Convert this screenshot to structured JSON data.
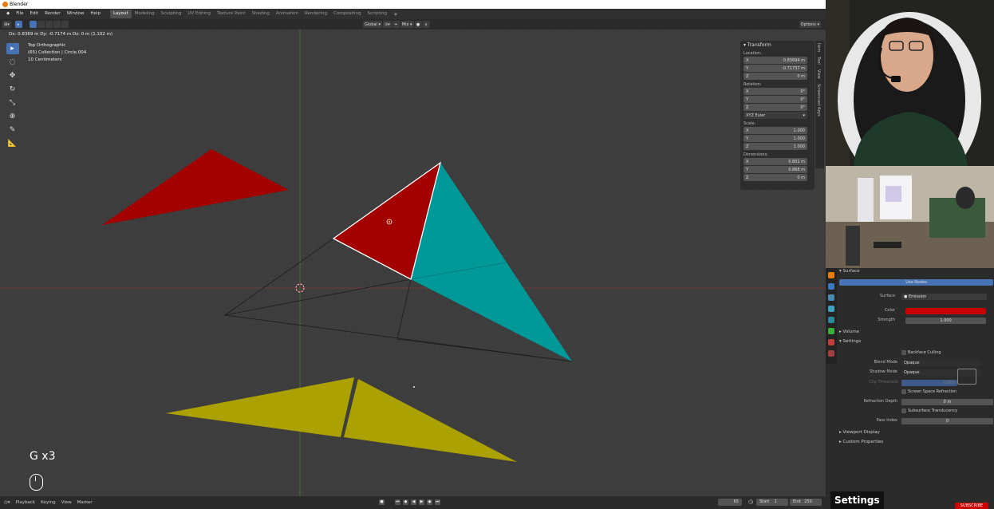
{
  "window": {
    "title": "Blender"
  },
  "menu": [
    "File",
    "Edit",
    "Render",
    "Window",
    "Help"
  ],
  "workspaces": [
    "Layout",
    "Modeling",
    "Sculpting",
    "UV Editing",
    "Texture Paint",
    "Shading",
    "Animation",
    "Rendering",
    "Compositing",
    "Scripting"
  ],
  "active_workspace": "Layout",
  "header": {
    "orientation": "Global",
    "proportional": "Mix",
    "options": "Options"
  },
  "viewport": {
    "delta": "Dx: 0.8369 m  Dy: -0.7174 m  Dz: 0 m (1.102 m)",
    "view_name": "Top Orthographic",
    "collection": "(65) Collection | Circle.004",
    "scale": "10 Centimeters",
    "keycast": "G x3"
  },
  "transform": {
    "title": "Transform",
    "location_label": "Location:",
    "location": [
      [
        "X",
        "0.83694 m"
      ],
      [
        "Y",
        "-0.71737 m"
      ],
      [
        "Z",
        "0 m"
      ]
    ],
    "rotation_label": "Rotation:",
    "rotation": [
      [
        "X",
        "0°"
      ],
      [
        "Y",
        "0°"
      ],
      [
        "Z",
        "0°"
      ]
    ],
    "rotation_mode": "XYZ Euler",
    "scale_label": "Scale:",
    "scale": [
      [
        "X",
        "1.000"
      ],
      [
        "Y",
        "1.000"
      ],
      [
        "Z",
        "1.000"
      ]
    ],
    "dimensions_label": "Dimensions:",
    "dimensions": [
      [
        "X",
        "0.802 m"
      ],
      [
        "Y",
        "0.868 m"
      ],
      [
        "Z",
        "0 m"
      ]
    ]
  },
  "npanel_tabs": [
    "Item",
    "Tool",
    "View",
    "Screencast Keys"
  ],
  "timeline": {
    "menus": [
      "Playback",
      "Keying",
      "View",
      "Marker"
    ],
    "current": "65",
    "start_label": "Start",
    "start": "1",
    "end_label": "End",
    "end": "250"
  },
  "properties": {
    "surface_header": "Surface",
    "use_nodes": "Use Nodes",
    "surface_label": "Surface",
    "surface_value": "Emission",
    "color_label": "Color",
    "color": "#c80000",
    "strength_label": "Strength",
    "strength": "1.000",
    "volume": "Volume",
    "settings": "Settings",
    "backface": "Backface Culling",
    "blend_label": "Blend Mode",
    "blend": "Opaque",
    "shadow_label": "Shadow Mode",
    "shadow": "Opaque",
    "clip_label": "Clip Threshold",
    "clip": "0.500",
    "ssr": "Screen Space Refraction",
    "refdepth_label": "Refraction Depth",
    "refdepth": "0 m",
    "subsurface": "Subsurface Translucency",
    "pass_label": "Pass Index",
    "pass": "0",
    "viewport_display": "Viewport Display",
    "custom_props": "Custom Properties"
  },
  "overlay": {
    "settings_caption": "Settings",
    "subscribe": "SUBSCRIBE"
  }
}
